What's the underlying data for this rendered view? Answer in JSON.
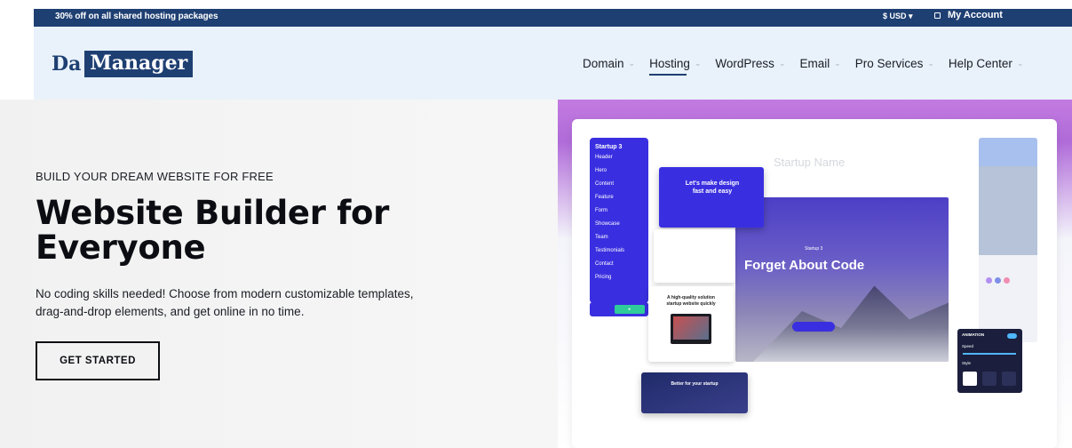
{
  "topbar": {
    "promo": "30% off on all shared hosting packages",
    "currency": "$ USD",
    "account": "My Account"
  },
  "brand": {
    "logo_part1": "Da",
    "logo_part2": "Manager",
    "primary_color": "#1e3f72"
  },
  "nav": {
    "items": [
      {
        "label": "Domain",
        "active": false
      },
      {
        "label": "Hosting",
        "active": true
      },
      {
        "label": "WordPress",
        "active": false
      },
      {
        "label": "Email",
        "active": false
      },
      {
        "label": "Pro Services",
        "active": false
      },
      {
        "label": "Help Center",
        "active": false
      }
    ]
  },
  "hero": {
    "eyebrow": "BUILD YOUR DREAM WEBSITE FOR FREE",
    "headline_line1": "Website Builder for",
    "headline_line2": "Everyone",
    "subtext_line1": "No coding skills needed! Choose from modern customizable templates,",
    "subtext_line2": "drag-and-drop elements, and get online in no time.",
    "cta_label": "GET STARTED"
  },
  "preview": {
    "sidebar_title": "Startup 3",
    "sidebar_items": [
      "Header",
      "Hero",
      "Content",
      "Feature",
      "Form",
      "Showcase",
      "Team",
      "Testimonials",
      "Contact",
      "Pricing"
    ],
    "startup_name": "Startup Name",
    "card_dark_text": "Let's make design fast and easy",
    "big_card_subtitle": "Startup 3",
    "big_card_title": "Forget About Code",
    "card_white2_text": "A high-quality solution startup website quickly",
    "card_bottom_text": "Better for your startup",
    "animation_label": "ANIMATION",
    "speed_label": "Speed",
    "style_label": "Style",
    "swatch_colors": [
      "#b28ff0",
      "#7e8fe8",
      "#f08db0"
    ]
  }
}
